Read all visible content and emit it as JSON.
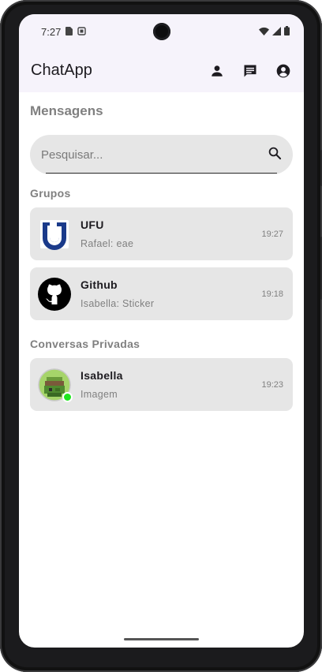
{
  "status_bar": {
    "time": "7:27"
  },
  "app_bar": {
    "title": "ChatApp",
    "actions": [
      "person-icon",
      "chat-icon",
      "account-circle-icon"
    ]
  },
  "page": {
    "title": "Mensagens"
  },
  "search": {
    "placeholder": "Pesquisar...",
    "value": ""
  },
  "sections": {
    "groups_title": "Grupos",
    "private_title": "Conversas Privadas"
  },
  "groups": [
    {
      "name": "UFU",
      "preview": "Rafael: eae",
      "time": "19:27",
      "avatar_icon": "ufu-logo-icon"
    },
    {
      "name": "Github",
      "preview": "Isabella: Sticker",
      "time": "19:18",
      "avatar_icon": "github-logo-icon"
    }
  ],
  "private_chats": [
    {
      "name": "Isabella",
      "preview": "Imagem",
      "time": "19:23",
      "online": true
    }
  ],
  "colors": {
    "app_bar_bg": "#f6f3fb",
    "item_bg": "#e6e6e6",
    "muted_text": "#808080",
    "online": "#1ee61e",
    "ufu_blue": "#1a3a8a"
  }
}
